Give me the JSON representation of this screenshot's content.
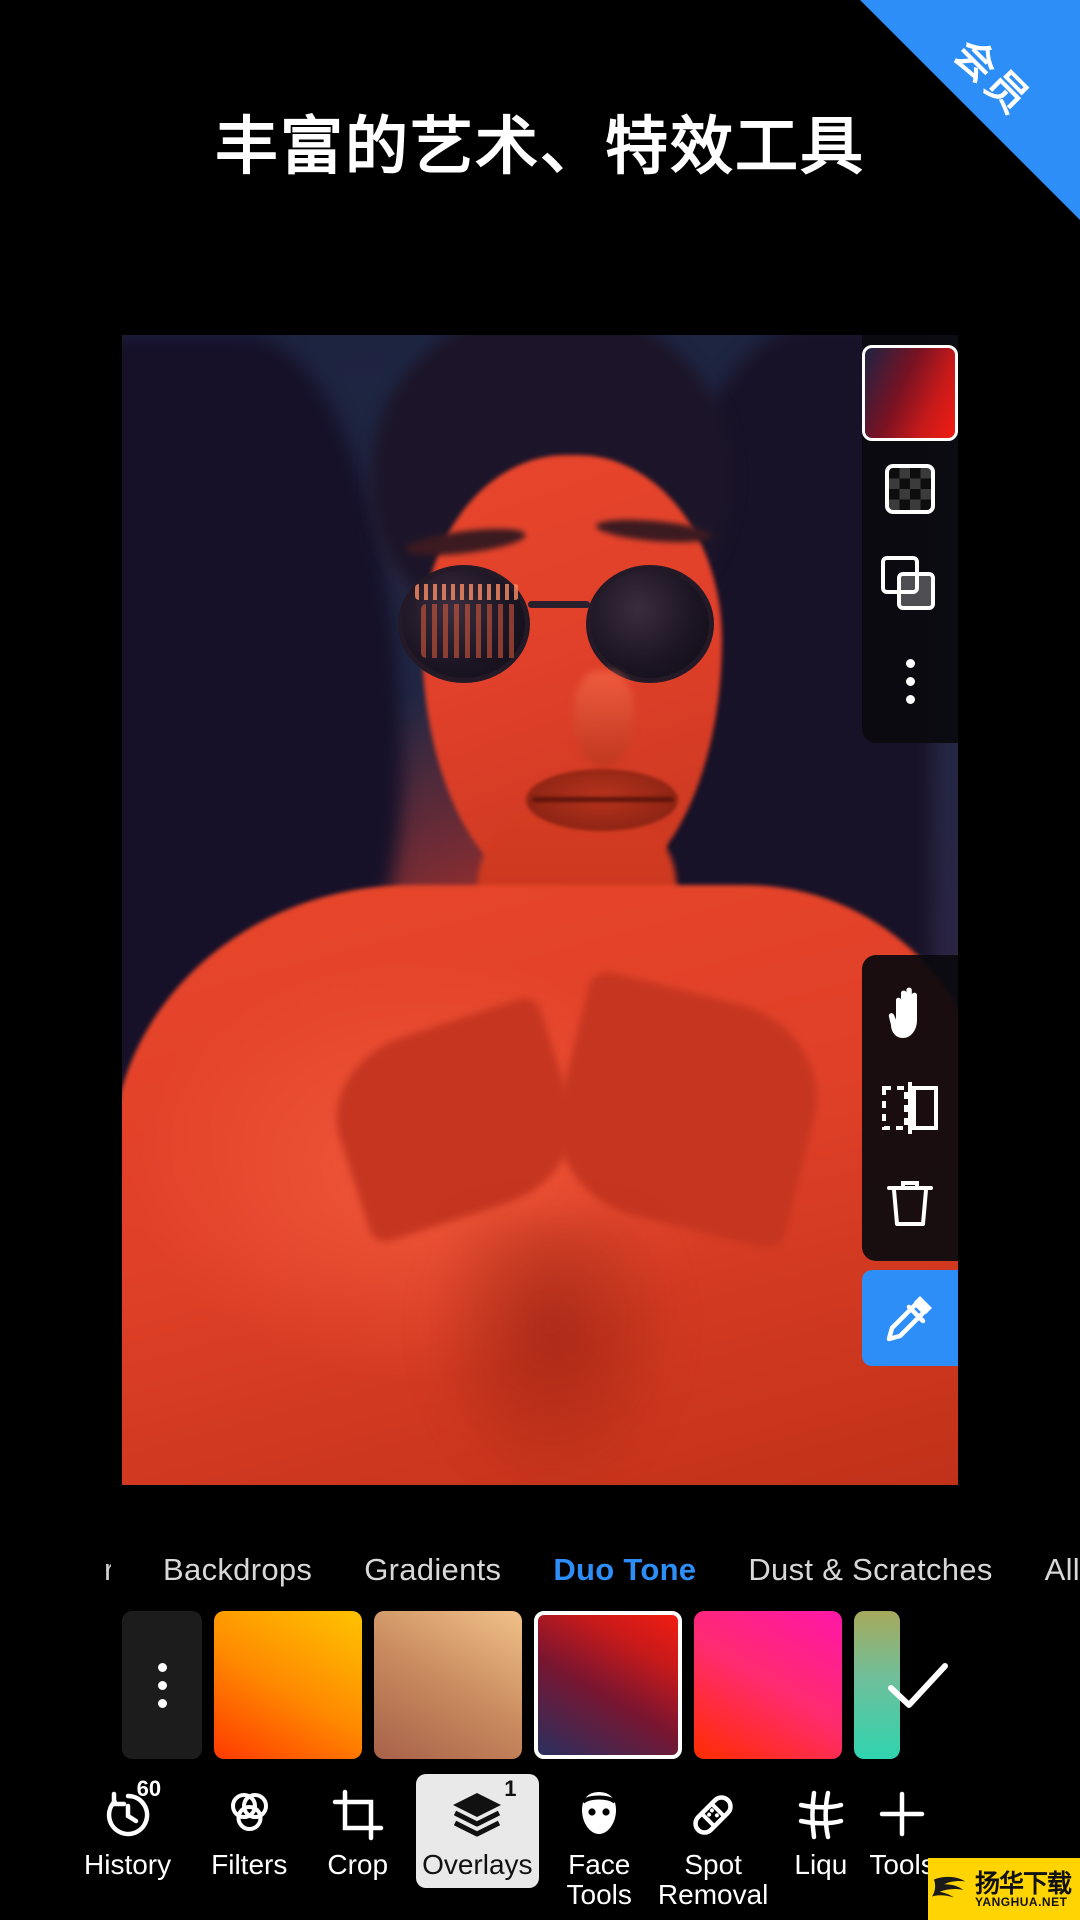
{
  "headline": "丰富的艺术、特效工具",
  "ribbon": {
    "label": "会员"
  },
  "canvas": {
    "layer_panel": {
      "thumbnail_name": "layer-thumbnail-duotone",
      "thumbnail_colors": [
        "#1d2344",
        "#7a1222",
        "#c81a1a",
        "#f11c13"
      ],
      "buttons": [
        {
          "name": "transparency-icon",
          "label": "Transparency"
        },
        {
          "name": "blend-mode-icon",
          "label": "Blend Mode"
        },
        {
          "name": "more-options-icon",
          "label": "More"
        }
      ]
    },
    "transform_panel": {
      "buttons": [
        {
          "name": "hand-icon",
          "label": "Pan"
        },
        {
          "name": "flip-horizontal-icon",
          "label": "Flip"
        },
        {
          "name": "trash-icon",
          "label": "Delete"
        }
      ]
    },
    "eyedropper": {
      "name": "eyedropper-icon",
      "label": "Color Picker",
      "color": "#2e8ef7"
    }
  },
  "tabs": [
    {
      "label": "r",
      "active": false,
      "truncated": true
    },
    {
      "label": "Backdrops",
      "active": false
    },
    {
      "label": "Gradients",
      "active": false
    },
    {
      "label": "Duo Tone",
      "active": true
    },
    {
      "label": "Dust & Scratches",
      "active": false
    },
    {
      "label": "All",
      "active": false
    }
  ],
  "active_tab_color": "#2e8ef7",
  "swatches": [
    {
      "name": "swatch-more",
      "type": "more"
    },
    {
      "name": "swatch-orange-yellow",
      "gradient": "linear-gradient(30deg,#ff3a00 0%,#ff8a00 48%,#ffc400 100%)",
      "selected": false
    },
    {
      "name": "swatch-tan-peach",
      "gradient": "linear-gradient(30deg,#a8614a 0%,#c98b5e 50%,#f0c18a 100%)",
      "selected": false
    },
    {
      "name": "swatch-red-navy",
      "gradient": "linear-gradient(30deg,#2a3060 0%,#7a1530 45%,#c81a1a 75%,#f11c13 100%)",
      "selected": true
    },
    {
      "name": "swatch-pink-magenta",
      "gradient": "linear-gradient(30deg,#ff2d00 0%,#ff2b6e 50%,#ff17a8 100%)",
      "selected": false
    },
    {
      "name": "swatch-teal-olive",
      "gradient": "linear-gradient(0deg,#2fd4b0 0%,#6fbf9a 55%,#a7a95c 100%)",
      "selected": false,
      "clipped": true
    }
  ],
  "confirm_button": {
    "name": "confirm-checkmark",
    "label": "Apply"
  },
  "toolbar": [
    {
      "name": "tool-history",
      "label": "History",
      "badge": "60",
      "active": false
    },
    {
      "name": "tool-filters",
      "label": "Filters",
      "badge": "",
      "active": false
    },
    {
      "name": "tool-crop",
      "label": "Crop",
      "badge": "",
      "active": false
    },
    {
      "name": "tool-overlays",
      "label": "Overlays",
      "badge": "1",
      "active": true
    },
    {
      "name": "tool-face-tools",
      "label": "Face\nTools",
      "badge": "",
      "active": false
    },
    {
      "name": "tool-spot-removal",
      "label": "Spot\nRemoval",
      "badge": "",
      "active": false
    },
    {
      "name": "tool-liquify",
      "label": "Liqu",
      "badge": "",
      "active": false
    },
    {
      "name": "tool-tools",
      "label": "Tools",
      "badge": "",
      "active": false
    }
  ],
  "watermark": {
    "cn": "扬华下载",
    "en": "YANGHUA.NET",
    "bg": "#ffd400"
  }
}
